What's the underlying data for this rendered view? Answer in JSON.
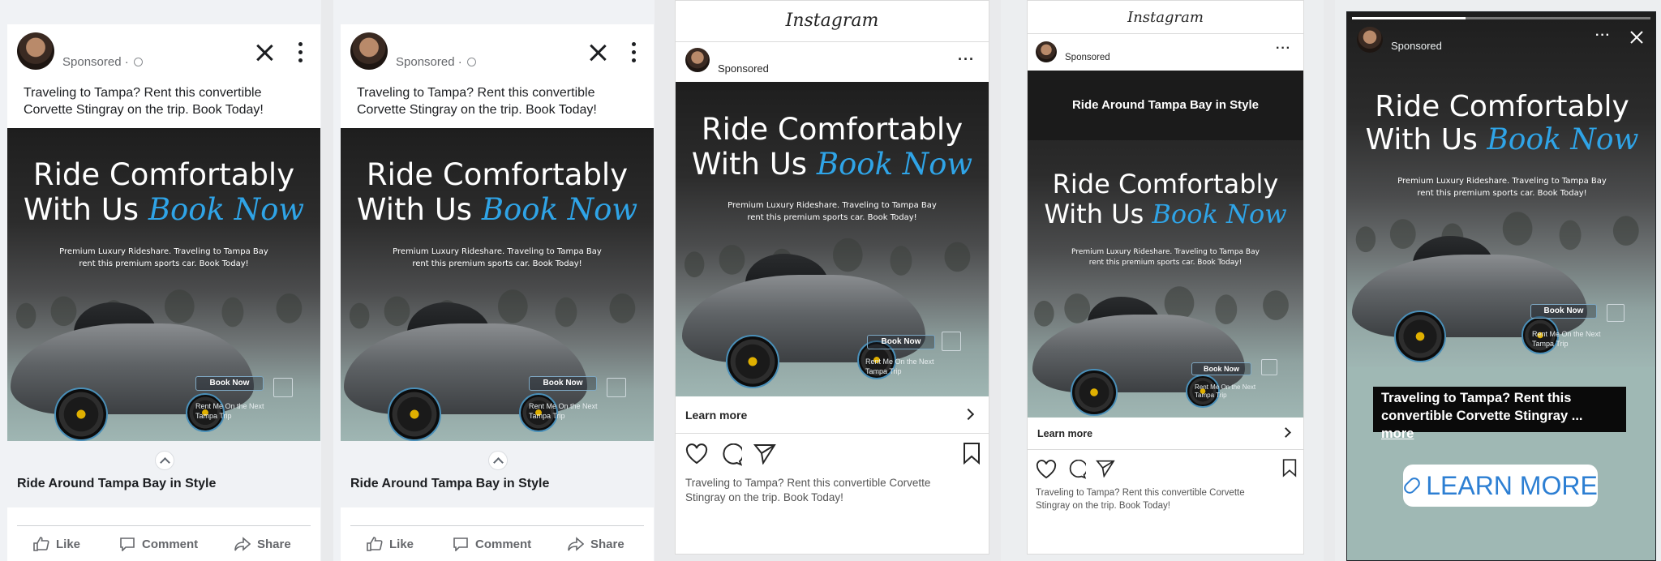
{
  "advertiser": {
    "sponsored_label": "Sponsored",
    "dot_sep": " · "
  },
  "creative": {
    "headline_line1": "Ride Comfortably",
    "headline_line2_prefix": "With Us",
    "headline_script": "Book Now",
    "subtext_line1": "Premium Luxury Rideshare. Traveling to Tampa Bay",
    "subtext_line2": "rent this premium sports car. Book Today!",
    "overlay_button": "Book Now",
    "overlay_note_line1": "Rent Me On the Next",
    "overlay_note_line2": "Tampa Trip",
    "banner_headline": "Ride Around Tampa Bay in Style",
    "accent_color": "#2fa4e7"
  },
  "post": {
    "caption_line1": "Traveling to Tampa? Rent this convertible",
    "caption_line2": "Corvette Stingray on the trip. Book Today!",
    "headline": "Ride Around Tampa Bay in Style"
  },
  "facebook": {
    "actions": {
      "like": "Like",
      "comment": "Comment",
      "share": "Share"
    }
  },
  "instagram": {
    "brand": "Instagram",
    "learn_more": "Learn more",
    "caption_line1": "Traveling to Tampa? Rent this convertible Corvette",
    "caption_line2": "Stingray on the trip. Book Today!"
  },
  "story": {
    "caption_line1": "Traveling to Tampa? Rent this",
    "caption_line2": "convertible Corvette Stingray ...",
    "more": "more",
    "cta": "LEARN MORE",
    "progress": 0.38
  }
}
